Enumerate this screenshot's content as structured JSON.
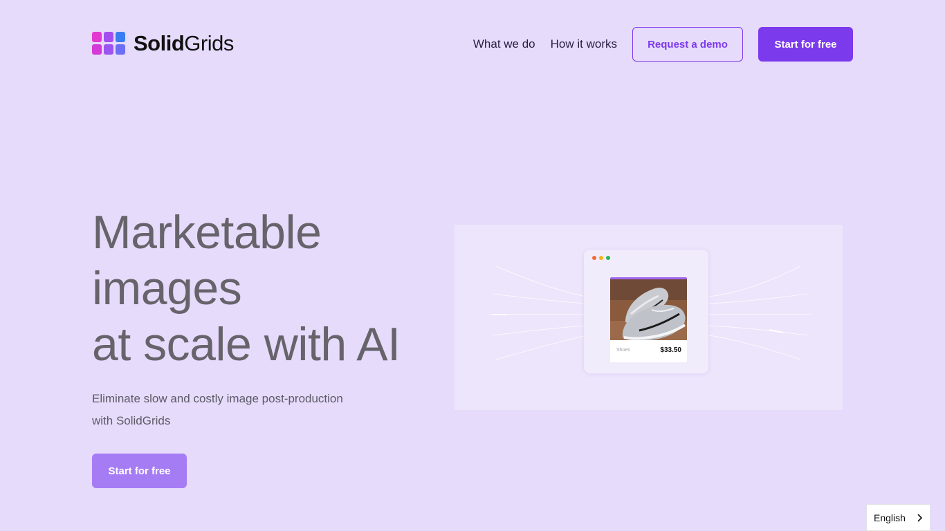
{
  "header": {
    "logo": {
      "text_bold": "Solid",
      "text_light": "Grids",
      "icon": "grid-logo-icon",
      "colors": [
        "#e23ad0",
        "#a44ef0",
        "#3a7cf2",
        "#d23bd8",
        "#9d55f0",
        "#6c6ef3"
      ]
    },
    "nav": {
      "what_we_do": "What we do",
      "how_it_works": "How it works",
      "request_demo": "Request a demo",
      "start_free": "Start for free"
    }
  },
  "hero": {
    "title_lines": [
      "Marketable",
      "images",
      "at scale with AI"
    ],
    "subtitle_line1": "Eliminate slow and costly image post-production",
    "subtitle_line2": "with SolidGrids",
    "cta": "Start for free"
  },
  "illustration": {
    "window_dots": [
      "#f06a3c",
      "#f5b31b",
      "#27b852"
    ],
    "product_image": "sneakers-photo",
    "product_label": "Shoes",
    "product_price": "$33.50"
  },
  "language_selector": {
    "value": "English",
    "icon": "chevron-right-icon"
  },
  "colors": {
    "background": "#e6dbfb",
    "accent": "#7c3aed",
    "cta_light": "#a67cf5",
    "heading": "#67636b"
  }
}
